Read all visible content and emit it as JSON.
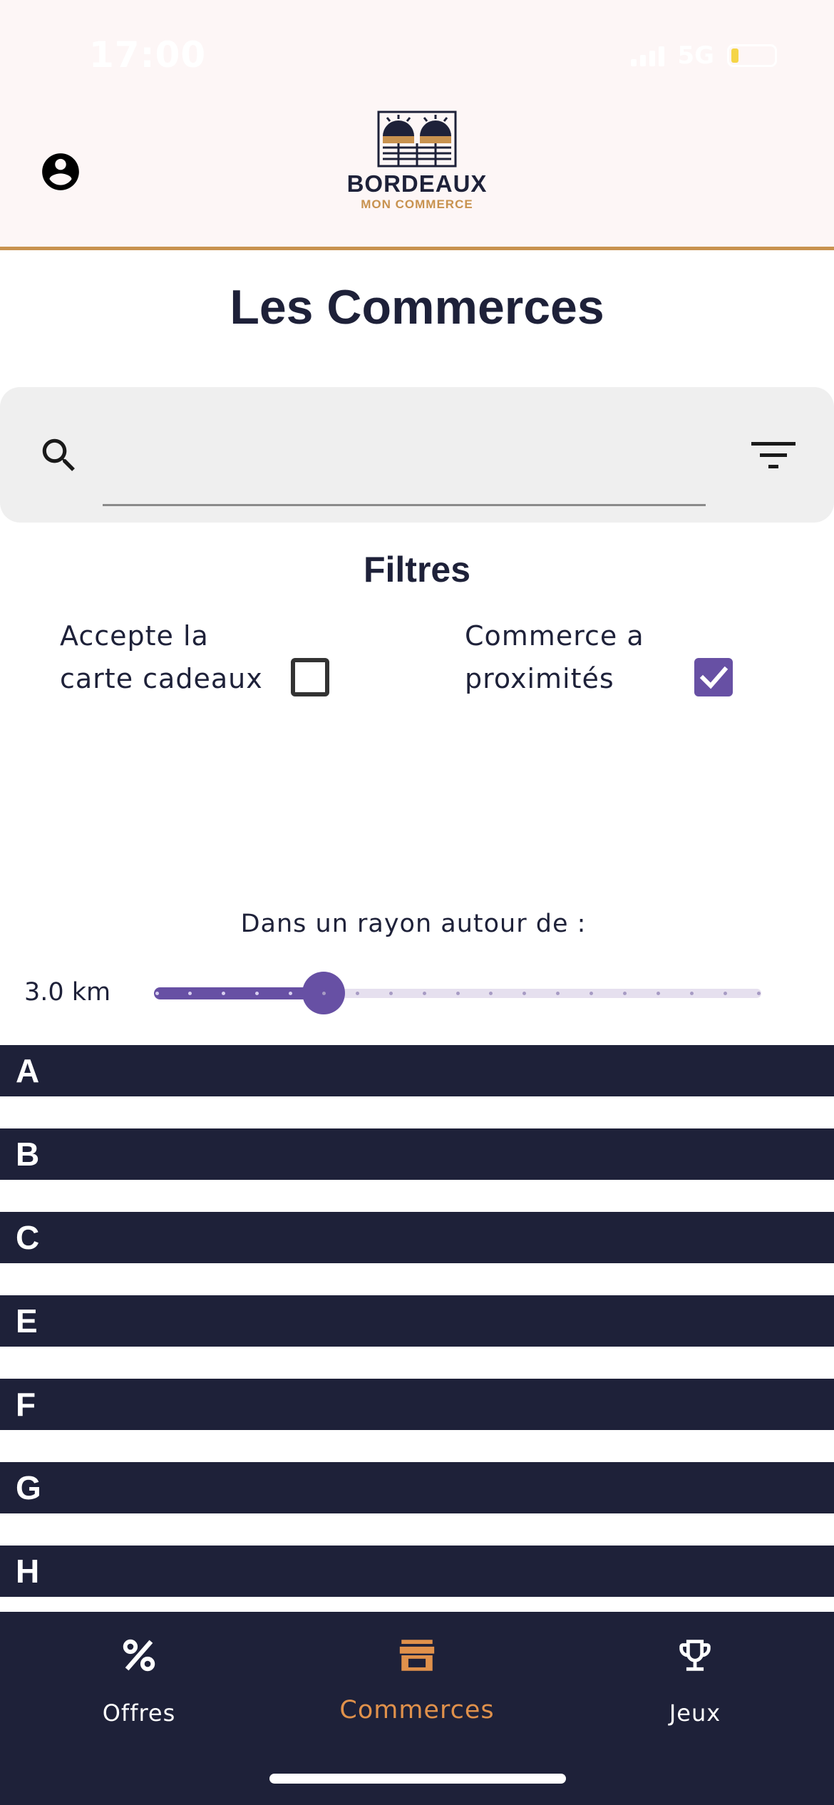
{
  "status_bar": {
    "time": "17:00",
    "network": "5G",
    "battery_color": "#f5d547"
  },
  "header": {
    "logo_title": "BORDEAUX",
    "logo_subtitle": "MON COMMERCE",
    "accent_color": "#c8924f",
    "icons": {
      "profile": "account-circle-icon"
    }
  },
  "page": {
    "title": "Les Commerces"
  },
  "search": {
    "value": "",
    "placeholder": "",
    "icons": {
      "search": "search-icon",
      "filter": "filter-icon"
    }
  },
  "filters": {
    "title": "Filtres",
    "gift_card": {
      "label": "Accepte la carte cadeaux",
      "checked": false
    },
    "nearby": {
      "label": "Commerce a proximités",
      "checked": true
    }
  },
  "radius": {
    "label": "Dans un rayon autour de :",
    "value_text": "3.0 km",
    "value_km": 3.0,
    "divisions": 19,
    "selected_index": 5
  },
  "sections": [
    "A",
    "B",
    "C",
    "E",
    "F",
    "G",
    "H"
  ],
  "bottom_nav": {
    "items": [
      {
        "label": "Offres",
        "icon": "percent-icon",
        "active": false
      },
      {
        "label": "Commerces",
        "icon": "store-icon",
        "active": true
      },
      {
        "label": "Jeux",
        "icon": "trophy-icon",
        "active": false
      }
    ],
    "active_color": "#e0914b",
    "inactive_color": "#ffffff"
  },
  "colors": {
    "navy": "#1e2139",
    "primary": "#6750a4"
  }
}
